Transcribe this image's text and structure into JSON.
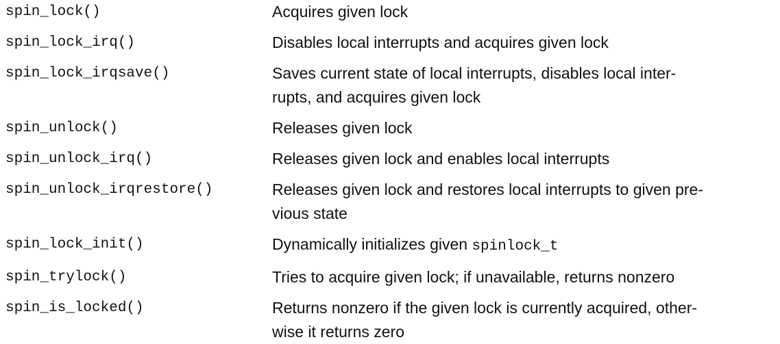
{
  "rows": [
    {
      "fn": "spin_lock()",
      "desc": "Acquires given lock"
    },
    {
      "fn": "spin_lock_irq()",
      "desc": "Disables local interrupts and acquires given lock"
    },
    {
      "fn": "spin_lock_irqsave()",
      "desc": "Saves current state of local interrupts, disables local inter-\nrupts, and acquires given lock"
    },
    {
      "fn": "spin_unlock()",
      "desc": "Releases given lock"
    },
    {
      "fn": "spin_unlock_irq()",
      "desc": "Releases given lock and enables local interrupts"
    },
    {
      "fn": "spin_unlock_irqrestore()",
      "desc": "Releases given lock and restores local interrupts to given pre-\nvious state"
    },
    {
      "fn": "spin_lock_init()",
      "desc_prefix": "Dynamically initializes given ",
      "desc_code": "spinlock_t"
    },
    {
      "fn": "spin_trylock()",
      "desc": "Tries to acquire given lock; if unavailable, returns nonzero"
    },
    {
      "fn": "spin_is_locked()",
      "desc": "Returns nonzero if the given lock is currently acquired, other-\nwise it returns zero"
    }
  ]
}
